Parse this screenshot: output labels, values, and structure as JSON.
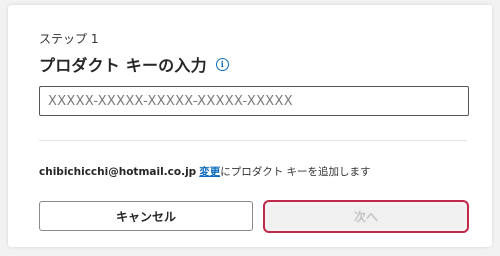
{
  "dialog": {
    "step_label": "ステップ 1",
    "title": "プロダクト キーの入力",
    "info_icon": "info-icon"
  },
  "product_key_input": {
    "value": "",
    "placeholder": "XXXXX-XXXXX-XXXXX-XXXXX-XXXXX"
  },
  "account": {
    "email": "chibichicchi@hotmail.co.jp",
    "change_link": "変更",
    "suffix_text": "にプロダクト キーを追加します"
  },
  "buttons": {
    "cancel_label": "キャンセル",
    "next_label": "次へ",
    "next_enabled": false
  },
  "colors": {
    "accent_link": "#0f6cbd",
    "focus_ring": "#c0294a",
    "disabled_text": "#c4c4c4"
  }
}
